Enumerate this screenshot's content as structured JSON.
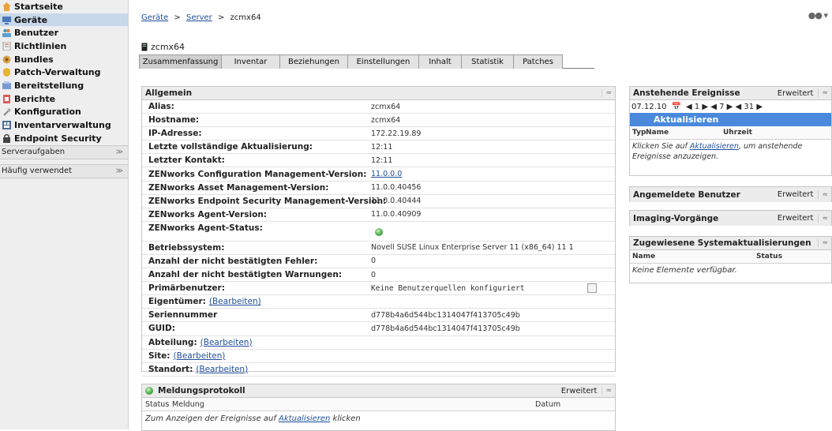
{
  "sidebar": {
    "items": [
      {
        "label": "Startseite",
        "icon": "home-icon"
      },
      {
        "label": "Geräte",
        "icon": "devices-icon",
        "selected": true
      },
      {
        "label": "Benutzer",
        "icon": "users-icon"
      },
      {
        "label": "Richtlinien",
        "icon": "policies-icon"
      },
      {
        "label": "Bundles",
        "icon": "bundles-icon"
      },
      {
        "label": "Patch-Verwaltung",
        "icon": "patch-icon"
      },
      {
        "label": "Bereitstellung",
        "icon": "deployment-icon"
      },
      {
        "label": "Berichte",
        "icon": "reports-icon"
      },
      {
        "label": "Konfiguration",
        "icon": "configuration-icon"
      },
      {
        "label": "Inventarverwaltung",
        "icon": "inventory-icon"
      },
      {
        "label": "Endpoint Security",
        "icon": "security-icon"
      }
    ],
    "sections": [
      {
        "label": "Serveraufgaben"
      },
      {
        "label": "Häufig verwendet"
      }
    ]
  },
  "breadcrumb": {
    "root": "Geräte",
    "mid": "Server",
    "current": "zcmx64",
    "sep": ">"
  },
  "device": {
    "name": "zcmx64"
  },
  "tabs": [
    "Zusammenfassung",
    "Inventar",
    "Beziehungen",
    "Einstellungen",
    "Inhalt",
    "Statistik",
    "Patches"
  ],
  "general": {
    "title": "Allgemein",
    "rows": [
      {
        "label": "Alias:",
        "value": "zcmx64"
      },
      {
        "label": "Hostname:",
        "value": "zcmx64"
      },
      {
        "label": "IP-Adresse:",
        "value": "172.22.19.89"
      },
      {
        "label": "Letzte vollständige Aktualisierung:",
        "value": "12:11"
      },
      {
        "label": "Letzter Kontakt:",
        "value": "12:11"
      },
      {
        "label": "ZENworks Configuration Management-Version:",
        "value": "11.0.0.0"
      },
      {
        "label": "ZENworks Asset Management-Version:",
        "value": "11.0.0.40456"
      },
      {
        "label": "ZENworks Endpoint Security Management-Version:",
        "value": "11.0.0.40444"
      },
      {
        "label": "ZENworks Agent-Version:",
        "value": "11.0.0.40909"
      },
      {
        "label": "ZENworks Agent-Status:",
        "value": ""
      },
      {
        "label": "Betriebssystem:",
        "value": "Novell SUSE Linux Enterprise Server 11 (x86_64) 11 1"
      },
      {
        "label": "Anzahl der nicht bestätigten Fehler:",
        "value": "0"
      },
      {
        "label": "Anzahl der nicht bestätigten Warnungen:",
        "value": "0"
      },
      {
        "label": "Primärbenutzer:",
        "value": "Keine Benutzerquellen konfiguriert"
      },
      {
        "label": "Eigentümer:",
        "value": ""
      },
      {
        "label": "Seriennummer",
        "value": "d778b4a6d544bc1314047f413705c49b"
      },
      {
        "label": "GUID:",
        "value": "d778b4a6d544bc1314047f413705c49b"
      },
      {
        "label": "Abteilung:",
        "value": ""
      },
      {
        "label": "Site:",
        "value": ""
      },
      {
        "label": "Standort:",
        "value": ""
      }
    ],
    "edit_link": "(Bearbeiten)"
  },
  "msglog": {
    "title": "Meldungsprotokoll",
    "advanced": "Erweitert",
    "col_status": "Status",
    "col_message": "Meldung",
    "col_date": "Datum",
    "note_pre": "Zum Anzeigen der Ereignisse auf",
    "note_link": "Aktualisieren",
    "note_post": "klicken"
  },
  "pending": {
    "title": "Anstehende Ereignisse",
    "advanced": "Erweitert",
    "date": "07.12.10",
    "nav": "◀ 1 ▶ ◀ 7 ▶ ◀ 31 ▶",
    "refresh": "Aktualisieren",
    "col_type": "Typ",
    "col_name": "Name",
    "col_time": "Uhrzeit",
    "note_pre": "Klicken Sie auf",
    "note_link": "Aktualisieren",
    "note_post": ", um anstehende Ereignisse anzuzeigen."
  },
  "logged_users": {
    "title": "Angemeldete Benutzer",
    "advanced": "Erweitert"
  },
  "imaging": {
    "title": "Imaging-Vorgänge",
    "advanced": "Erweitert"
  },
  "sysupdates": {
    "title": "Zugewiesene Systemaktualisierungen",
    "col_name": "Name",
    "col_status": "Status",
    "empty": "Keine Elemente verfügbar."
  },
  "colors": {
    "accent": "#4a89dc",
    "selected_nav": "#c7d8ea",
    "status_ok": "#5cb85c"
  }
}
